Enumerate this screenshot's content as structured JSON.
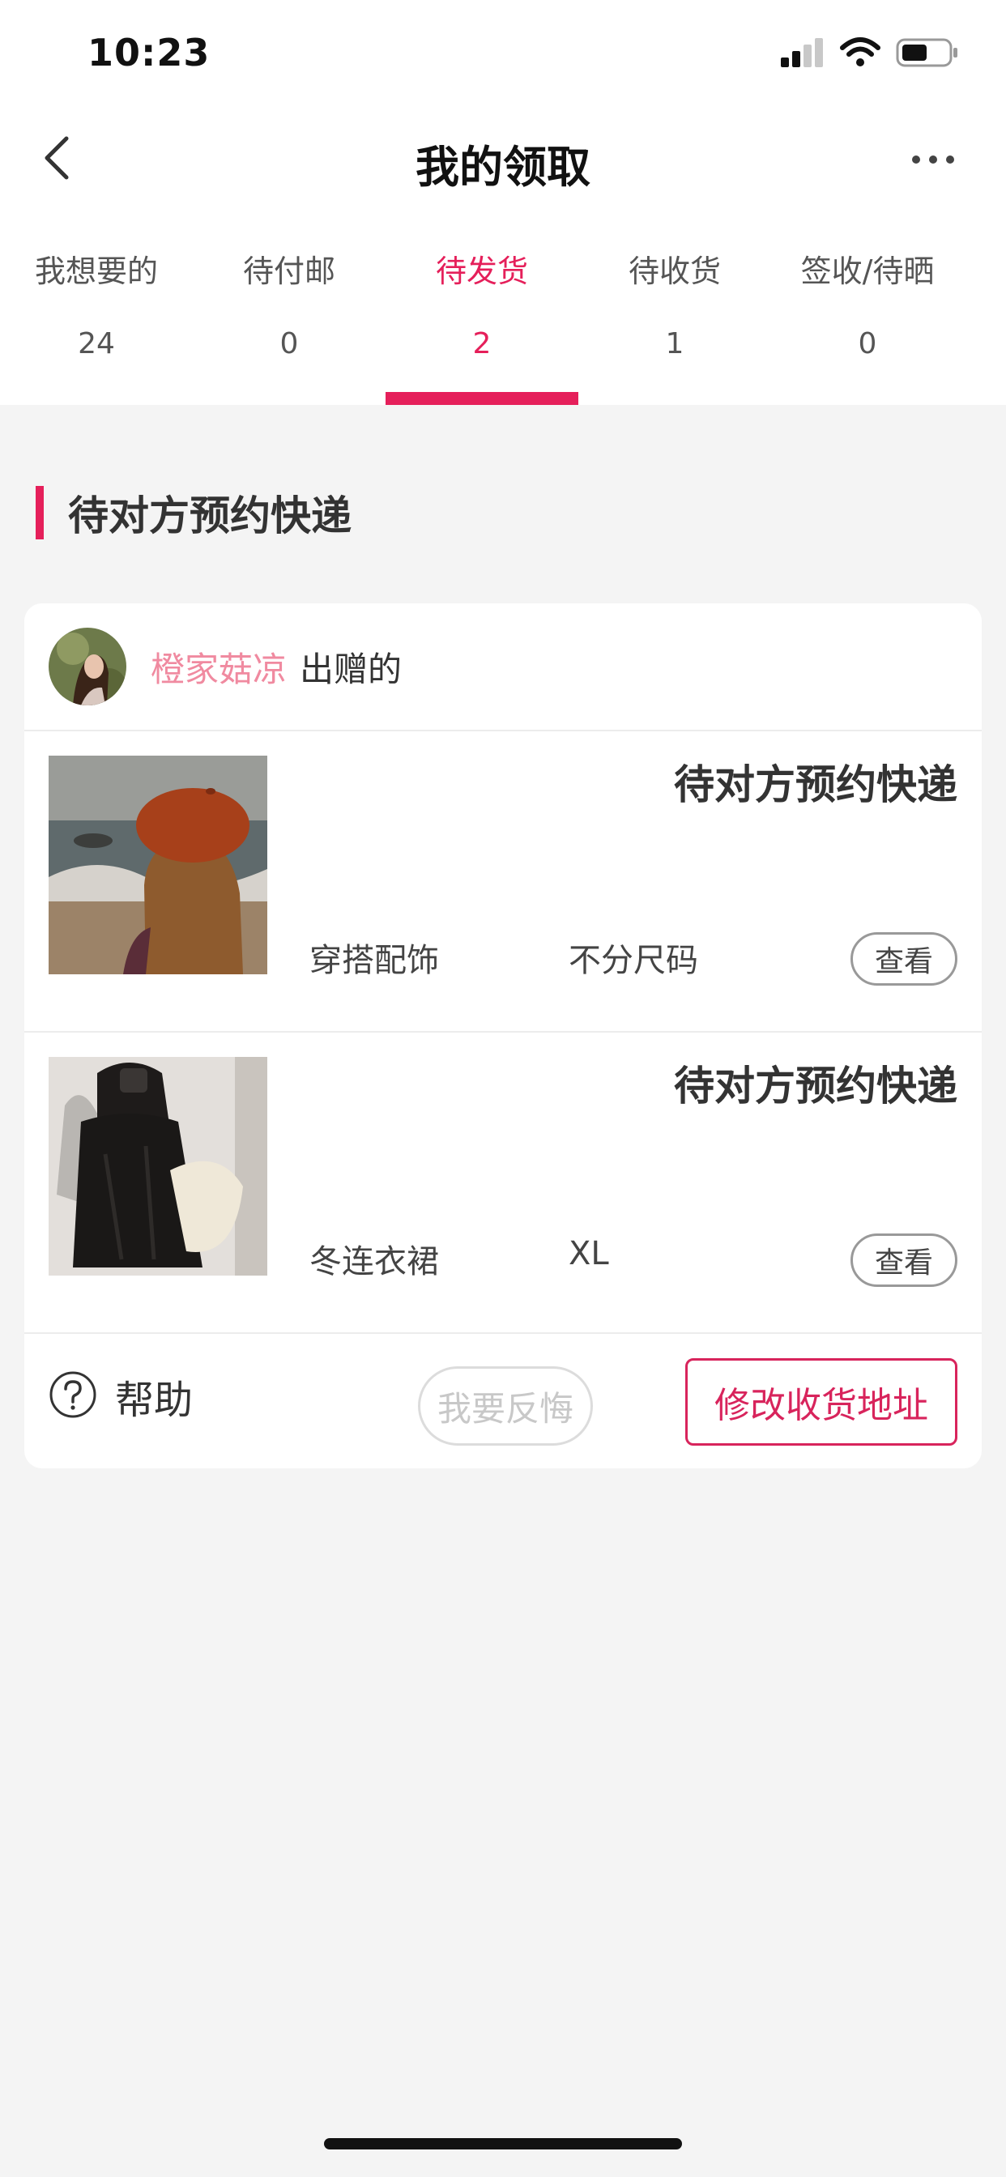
{
  "status_bar": {
    "time": "10:23"
  },
  "nav": {
    "title": "我的领取"
  },
  "tabs": [
    {
      "label": "我想要的",
      "count": "24"
    },
    {
      "label": "待付邮",
      "count": "0"
    },
    {
      "label": "待发货",
      "count": "2"
    },
    {
      "label": "待收货",
      "count": "1"
    },
    {
      "label": "签收/待晒",
      "count": "0"
    }
  ],
  "active_tab": "待发货",
  "section": {
    "title": "待对方预约快递"
  },
  "order": {
    "donor_name": "橙家菇凉",
    "donor_suffix": "出赠的",
    "items": [
      {
        "status": "待对方预约快递",
        "category": "穿搭配饰",
        "size": "不分尺码",
        "view_label": "查看"
      },
      {
        "status": "待对方预约快递",
        "category": "冬连衣裙",
        "size": "XL",
        "view_label": "查看"
      }
    ],
    "help_label": "帮助",
    "regret_label": "我要反悔",
    "edit_address_label": "修改收货地址"
  },
  "colors": {
    "accent": "#e51f5a",
    "donor_name": "#f08aa0",
    "background": "#f4f4f4"
  }
}
